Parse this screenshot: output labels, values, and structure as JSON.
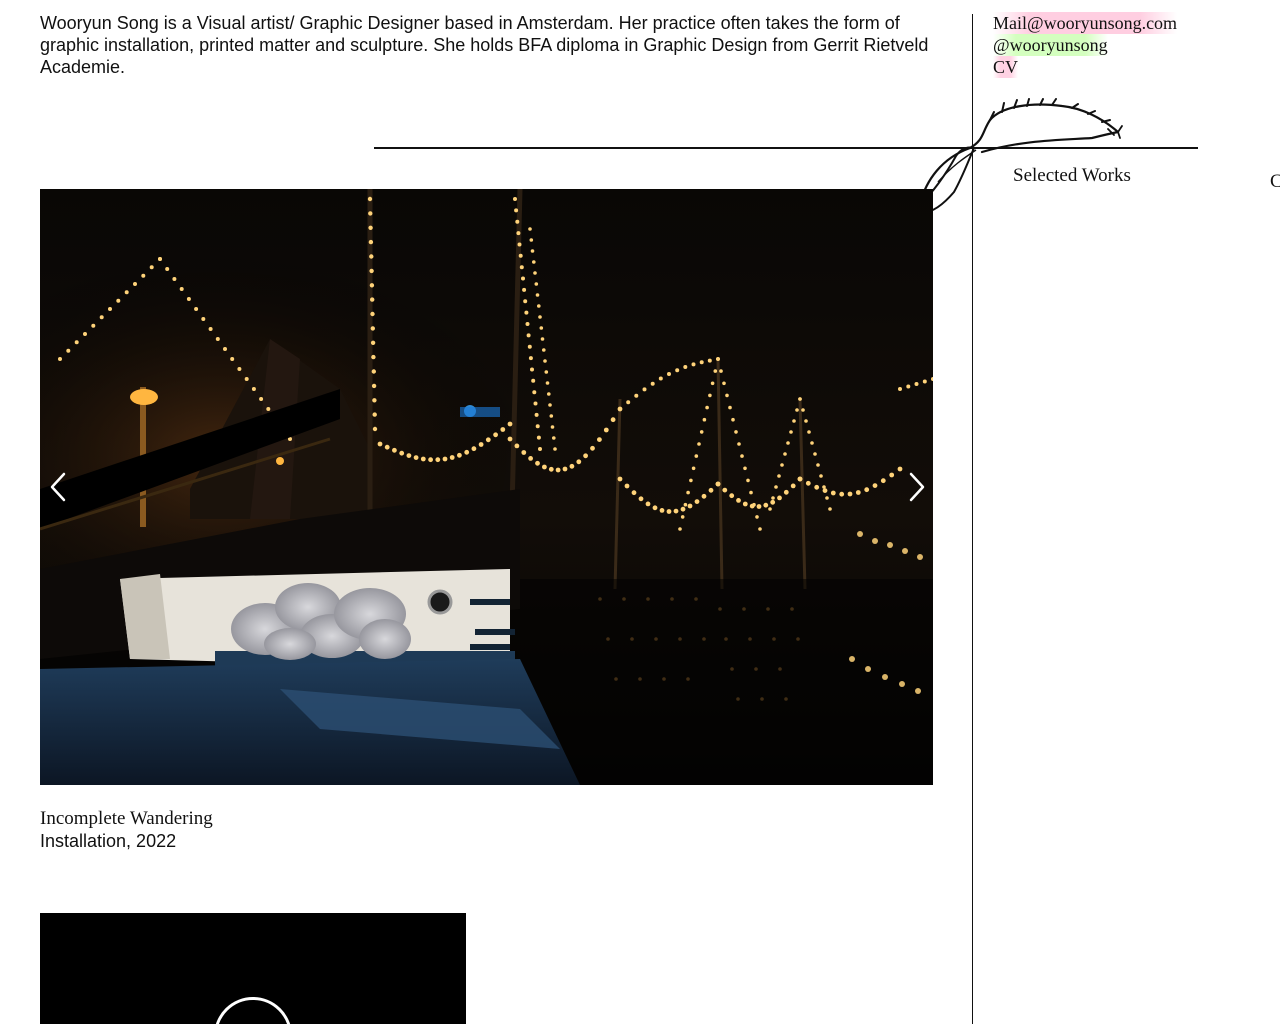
{
  "bio": {
    "text": "Wooryun Song is a Visual artist/ Graphic Designer based in Amsterdam. Her practice often takes the form of graphic installation, printed matter and sculpture. She holds BFA diploma in Graphic Design from Gerrit Rietveld Academie."
  },
  "contact": {
    "mail": "Mail@wooryunsong.com",
    "instagram": "@wooryunsong",
    "cv": "CV"
  },
  "nav": {
    "selected_works": "Selected Works",
    "clipped_item": "C"
  },
  "works": [
    {
      "title": "Incomplete Wandering",
      "meta": "Installation, 2022"
    }
  ],
  "icons": {
    "prev": "chevron-left-icon",
    "next": "chevron-right-icon",
    "feather": "feather-icon",
    "loading": "loading-spinner-icon"
  },
  "colors": {
    "mail_highlight": "#ffbed7",
    "instagram_highlight": "#cdffb4",
    "text": "#111111",
    "background": "#ffffff"
  }
}
